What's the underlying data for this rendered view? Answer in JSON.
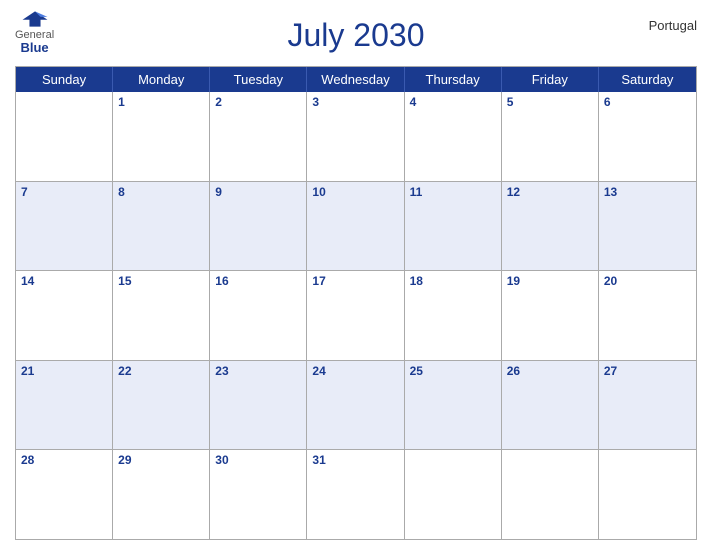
{
  "header": {
    "title": "July 2030",
    "country": "Portugal",
    "logo_general": "General",
    "logo_blue": "Blue"
  },
  "calendar": {
    "day_headers": [
      "Sunday",
      "Monday",
      "Tuesday",
      "Wednesday",
      "Thursday",
      "Friday",
      "Saturday"
    ],
    "weeks": [
      [
        {
          "num": "",
          "empty": true
        },
        {
          "num": "1"
        },
        {
          "num": "2"
        },
        {
          "num": "3"
        },
        {
          "num": "4"
        },
        {
          "num": "5"
        },
        {
          "num": "6"
        }
      ],
      [
        {
          "num": "7"
        },
        {
          "num": "8"
        },
        {
          "num": "9"
        },
        {
          "num": "10"
        },
        {
          "num": "11"
        },
        {
          "num": "12"
        },
        {
          "num": "13"
        }
      ],
      [
        {
          "num": "14"
        },
        {
          "num": "15"
        },
        {
          "num": "16"
        },
        {
          "num": "17"
        },
        {
          "num": "18"
        },
        {
          "num": "19"
        },
        {
          "num": "20"
        }
      ],
      [
        {
          "num": "21"
        },
        {
          "num": "22"
        },
        {
          "num": "23"
        },
        {
          "num": "24"
        },
        {
          "num": "25"
        },
        {
          "num": "26"
        },
        {
          "num": "27"
        }
      ],
      [
        {
          "num": "28"
        },
        {
          "num": "29"
        },
        {
          "num": "30"
        },
        {
          "num": "31"
        },
        {
          "num": "",
          "empty": true
        },
        {
          "num": "",
          "empty": true
        },
        {
          "num": "",
          "empty": true
        }
      ]
    ]
  }
}
